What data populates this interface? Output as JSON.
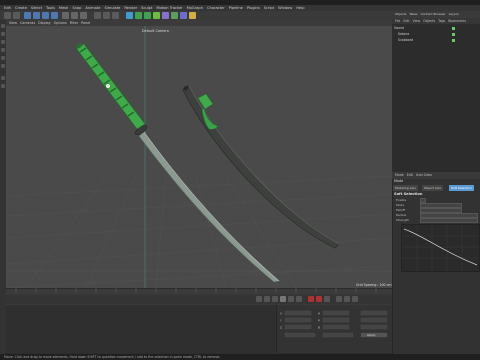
{
  "menu": {
    "items": [
      "Edit",
      "Create",
      "Select",
      "Tools",
      "Mesh",
      "Snap",
      "Animate",
      "Simulate",
      "Render",
      "Sculpt",
      "Motion Tracker",
      "MoGraph",
      "Character",
      "Pipeline",
      "Plugins",
      "Script",
      "Window",
      "Help"
    ]
  },
  "viewport": {
    "menu": [
      "View",
      "Cameras",
      "Display",
      "Options",
      "Filter",
      "Panel"
    ],
    "title": "Default Camera",
    "grid_spacing": "Grid Spacing : 100 cm"
  },
  "object_manager": {
    "tabs": [
      "Objects",
      "Takes",
      "Content Browser",
      "Layers"
    ],
    "menu": [
      "File",
      "Edit",
      "View",
      "Objects",
      "Tags",
      "Bookmarks"
    ],
    "rows": [
      "Sword",
      "Katana",
      "Scabbard"
    ]
  },
  "attributes": {
    "menu": [
      "Mode",
      "Edit",
      "User Data"
    ],
    "mode_label": "Mode",
    "tabs": [
      "Modeling Axis",
      "Object Axis",
      "Soft Selection"
    ],
    "section": "Soft Selection",
    "rows": [
      "Enable",
      "Mode",
      "Falloff",
      "Radius",
      "Strength",
      "Width"
    ]
  },
  "statusbar": {
    "text": "Move: Click and drag to move elements. Hold down SHIFT to quantize movement / add to the selection in point mode, CTRL to remove."
  },
  "coords": {
    "labels": [
      "X",
      "Y",
      "Z",
      "H",
      "P",
      "B"
    ],
    "apply_label": "Apply"
  },
  "colors": {
    "accent": "#5b9bd5",
    "handle_green": "#39b54a",
    "blade": "#8a9a90"
  }
}
